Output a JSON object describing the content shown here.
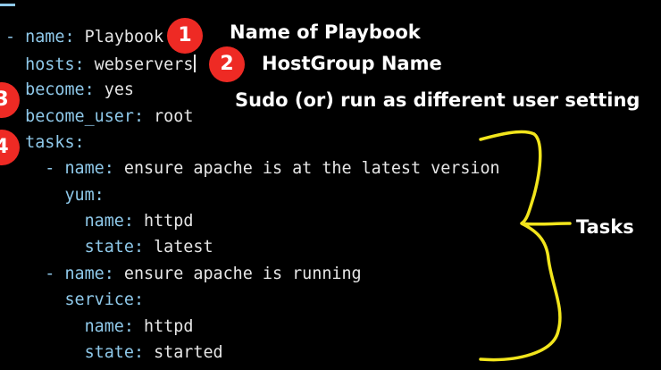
{
  "code": {
    "lines": [
      {
        "indent": "- ",
        "key": "name:",
        "value": " Playbook"
      },
      {
        "indent": "  ",
        "key": "hosts:",
        "value": " webservers"
      },
      {
        "indent": "  ",
        "key": "become:",
        "value": " yes"
      },
      {
        "indent": "  ",
        "key": "become_user:",
        "value": " root"
      },
      {
        "indent": "  ",
        "key": "tasks:",
        "value": ""
      },
      {
        "indent": "    - ",
        "key": "name:",
        "value": " ensure apache is at the latest version"
      },
      {
        "indent": "      ",
        "key": "yum:",
        "value": ""
      },
      {
        "indent": "        ",
        "key": "name:",
        "value": " httpd"
      },
      {
        "indent": "        ",
        "key": "state:",
        "value": " latest"
      },
      {
        "indent": "    - ",
        "key": "name:",
        "value": " ensure apache is running"
      },
      {
        "indent": "      ",
        "key": "service:",
        "value": ""
      },
      {
        "indent": "        ",
        "key": "name:",
        "value": " httpd"
      },
      {
        "indent": "        ",
        "key": "state:",
        "value": " started"
      }
    ]
  },
  "badges": [
    "1",
    "2",
    "3",
    "4"
  ],
  "annotations": {
    "playbook_name": "Name of Playbook",
    "host_group": "HostGroup Name",
    "sudo": "Sudo (or) run as different user setting",
    "tasks": "Tasks"
  },
  "colors": {
    "background": "#000000",
    "key": "#8fc9ea",
    "value": "#e6e6e6",
    "badge": "#ee2a24",
    "brace": "#f2e51c",
    "label": "#ffffff"
  }
}
